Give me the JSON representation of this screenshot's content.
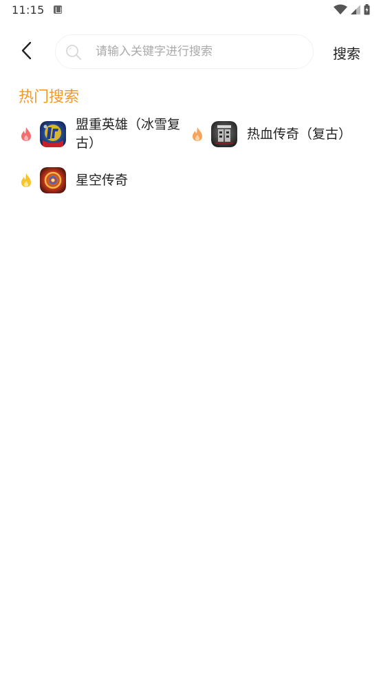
{
  "status_bar": {
    "time": "11:15"
  },
  "header": {
    "back_icon": "chevron-left-icon",
    "search_placeholder": "请输入关键字进行搜索",
    "search_value": "",
    "search_button_label": "搜索"
  },
  "hot_search": {
    "title": "热门搜索",
    "title_color": "#f39a24",
    "items": [
      {
        "name": "盟重英雄（冰雪复古）",
        "icon": "game-icon-chuanqi",
        "flame_color": "#f26d6d"
      },
      {
        "name": "热血传奇（复古）",
        "icon": "game-icon-long",
        "flame_color": "#f5a45b"
      },
      {
        "name": "星空传奇",
        "icon": "game-icon-xingkong",
        "flame_color": "#f7c52a"
      }
    ]
  }
}
